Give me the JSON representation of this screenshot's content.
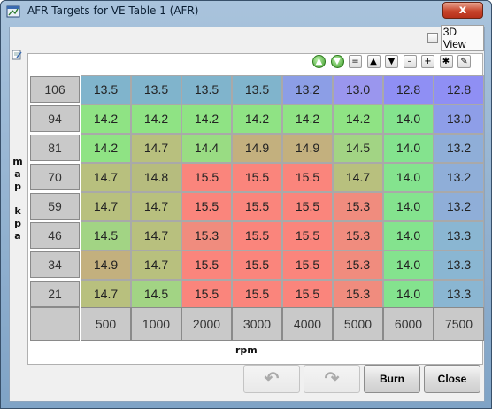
{
  "window": {
    "title": "AFR Targets for VE Table 1 (AFR)",
    "close_glyph": "x"
  },
  "view3d": {
    "label": "3D View",
    "checked": false
  },
  "toolbar": {
    "buttons": [
      {
        "name": "increase-green-icon",
        "glyph": "▲"
      },
      {
        "name": "decrease-green-icon",
        "glyph": "▼"
      },
      {
        "name": "equals-icon",
        "glyph": "="
      },
      {
        "name": "up-arrow-icon",
        "glyph": "▲"
      },
      {
        "name": "down-arrow-icon",
        "glyph": "▼"
      },
      {
        "name": "minus-icon",
        "glyph": "–"
      },
      {
        "name": "plus-icon",
        "glyph": "+"
      },
      {
        "name": "multiply-icon",
        "glyph": "✱"
      },
      {
        "name": "pencil-icon",
        "glyph": "✎"
      }
    ]
  },
  "axes": {
    "y_label": "map kpa",
    "x_label": "rpm",
    "y_values": [
      "106",
      "94",
      "81",
      "70",
      "59",
      "46",
      "34",
      "21"
    ],
    "x_values": [
      "500",
      "1000",
      "2000",
      "3000",
      "4000",
      "5000",
      "6000",
      "7500"
    ]
  },
  "table": {
    "rows": [
      [
        "13.5",
        "13.5",
        "13.5",
        "13.5",
        "13.2",
        "13.0",
        "12.8",
        "12.8"
      ],
      [
        "14.2",
        "14.2",
        "14.2",
        "14.2",
        "14.2",
        "14.2",
        "14.0",
        "13.0"
      ],
      [
        "14.2",
        "14.7",
        "14.4",
        "14.9",
        "14.9",
        "14.5",
        "14.0",
        "13.2"
      ],
      [
        "14.7",
        "14.8",
        "15.5",
        "15.5",
        "15.5",
        "14.7",
        "14.0",
        "13.2"
      ],
      [
        "14.7",
        "14.7",
        "15.5",
        "15.5",
        "15.5",
        "15.3",
        "14.0",
        "13.2"
      ],
      [
        "14.5",
        "14.7",
        "15.3",
        "15.5",
        "15.5",
        "15.3",
        "14.0",
        "13.3"
      ],
      [
        "14.9",
        "14.7",
        "15.5",
        "15.5",
        "15.5",
        "15.3",
        "14.0",
        "13.3"
      ],
      [
        "14.7",
        "14.5",
        "15.5",
        "15.5",
        "15.5",
        "15.3",
        "14.0",
        "13.3"
      ]
    ],
    "colors": [
      [
        "#80b4cc",
        "#80b4cc",
        "#80b4cc",
        "#80b4cc",
        "#8c9ee6",
        "#9a96ee",
        "#8f8ff4",
        "#8f8ff4"
      ],
      [
        "#8fe384",
        "#8fe384",
        "#8fe384",
        "#8fe384",
        "#8fe384",
        "#8fe384",
        "#84e38e",
        "#8e9ee8"
      ],
      [
        "#8fe384",
        "#b8c07e",
        "#99dc83",
        "#c3b07e",
        "#c3b07e",
        "#a2d484",
        "#84e38e",
        "#8faed8"
      ],
      [
        "#b8c07e",
        "#b6bc7e",
        "#fa857c",
        "#fa857c",
        "#fa857c",
        "#b8c07e",
        "#84e38e",
        "#8faed8"
      ],
      [
        "#b8c07e",
        "#b8c07e",
        "#fa857c",
        "#fa857c",
        "#fa857c",
        "#f08c7e",
        "#84e38e",
        "#8faed8"
      ],
      [
        "#a2d484",
        "#b8c07e",
        "#f08c7e",
        "#fa857c",
        "#fa857c",
        "#f08c7e",
        "#84e38e",
        "#8ab6d2"
      ],
      [
        "#c3b07e",
        "#b8c07e",
        "#fa857c",
        "#fa857c",
        "#fa857c",
        "#f08c7e",
        "#84e38e",
        "#8ab6d2"
      ],
      [
        "#b8c07e",
        "#a2d484",
        "#fa857c",
        "#fa857c",
        "#fa857c",
        "#f08c7e",
        "#84e38e",
        "#8ab6d2"
      ]
    ]
  },
  "buttons": {
    "undo": "↶",
    "redo": "↷",
    "burn": "Burn",
    "close": "Close"
  }
}
